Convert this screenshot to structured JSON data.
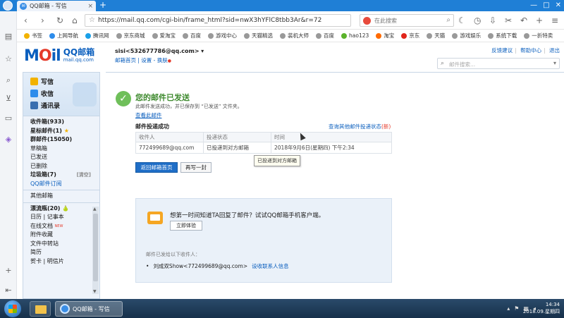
{
  "browser": {
    "tab_title": "QQ邮箱 - 写信",
    "tab_icon": "qq-mail-icon",
    "url": "https://mail.qq.com/cgi-bin/frame_html?sid=nwX3hYFlC8tbb3Ar&r=72",
    "search_placeholder": "在此搜索",
    "new_tab": "+",
    "window_controls": [
      "—",
      "□",
      "✕"
    ]
  },
  "bookmarks": [
    {
      "label": "书签",
      "color": "#f2b200"
    },
    {
      "label": "上网导航",
      "color": "#2d8ceb"
    },
    {
      "label": "腾讯网",
      "color": "#1aa0e8"
    },
    {
      "label": "京东商城",
      "color": "#999999"
    },
    {
      "label": "爱淘宝",
      "color": "#999999"
    },
    {
      "label": "百度",
      "color": "#999999"
    },
    {
      "label": "游戏中心",
      "color": "#999999"
    },
    {
      "label": "天猫精选",
      "color": "#999999"
    },
    {
      "label": "装机大师",
      "color": "#999999"
    },
    {
      "label": "百度",
      "color": "#999999"
    },
    {
      "label": "hao123",
      "color": "#5bb32b"
    },
    {
      "label": "淘宝",
      "color": "#ff6a00"
    },
    {
      "label": "京东",
      "color": "#e1251b"
    },
    {
      "label": "天猫",
      "color": "#999999"
    },
    {
      "label": "游戏娱乐",
      "color": "#999999"
    },
    {
      "label": "系统下载",
      "color": "#999999"
    },
    {
      "label": "一折特卖",
      "color": "#999999"
    }
  ],
  "mail": {
    "logo_letters": "MOil",
    "logo_name": "QQ邮箱",
    "logo_domain": "mail.qq.com",
    "account": "sisi<532677786@qq.com>",
    "account_links": "邮箱首页 | 设置 - 换肤",
    "top_links": [
      "反馈建议",
      "帮助中心",
      "退出"
    ],
    "search_placeholder": "邮件搜索..."
  },
  "nav": {
    "compose": [
      {
        "label": "写信",
        "color": "#f2b200"
      },
      {
        "label": "收信",
        "color": "#2d8ceb"
      },
      {
        "label": "通讯录",
        "color": "#3a6fb0"
      }
    ],
    "folders_a": [
      {
        "label": "收件箱(933)",
        "bold": true
      },
      {
        "label": "星标邮件(1)",
        "bold": true,
        "star": "★"
      },
      {
        "label": "群邮件(15050)",
        "bold": true
      },
      {
        "label": "草稿箱"
      },
      {
        "label": "已发送"
      },
      {
        "label": "已删除"
      },
      {
        "label": "垃圾箱(7)",
        "bold": true,
        "tag": "[清空]"
      },
      {
        "label": "QQ邮件订阅",
        "link": true
      }
    ],
    "folders_b": [
      {
        "label": "其他邮箱"
      }
    ],
    "folders_c": [
      {
        "label": "漂流瓶(20)",
        "bold": true,
        "star": "🍐"
      },
      {
        "label": "日历 | 记事本"
      },
      {
        "label": "在线文档",
        "new": "NEW"
      },
      {
        "label": "附件收藏"
      },
      {
        "label": "文件中转站"
      },
      {
        "label": "简历"
      },
      {
        "label": "贺卡 | 明信片"
      }
    ]
  },
  "main": {
    "success_title": "您的邮件已发送",
    "success_sub": "此邮件发送成功，并已保存到 “已发送” 文件夹。",
    "view_mail": "查看此邮件",
    "delivery_header": "邮件投递成功",
    "query_link": "查询其他邮件投递状态",
    "query_count": "(新)",
    "table": {
      "headers": [
        "收件人",
        "投递状态",
        "时间"
      ],
      "rows": [
        [
          "772499689@qq.com",
          "已投递到对方邮箱",
          "2018年9月6日(星期四) 下午2:34"
        ]
      ]
    },
    "tooltip": "已投递到对方邮箱",
    "btn_back": "返回邮箱首页",
    "btn_write": "再写一封",
    "promo_title": "想第一时间知道TA回复了邮件？试试QQ邮箱手机客户端。",
    "promo_btn": "立即体验",
    "promo_label": "邮件已发给以下收件人：",
    "promo_recipient": "刘成双Show<772499689@qq.com>",
    "promo_action": "设收联系人信息"
  },
  "taskbar": {
    "browser_label": "QQ邮箱 - 写信",
    "time": "14:34",
    "date": "2018.09.星期四"
  }
}
